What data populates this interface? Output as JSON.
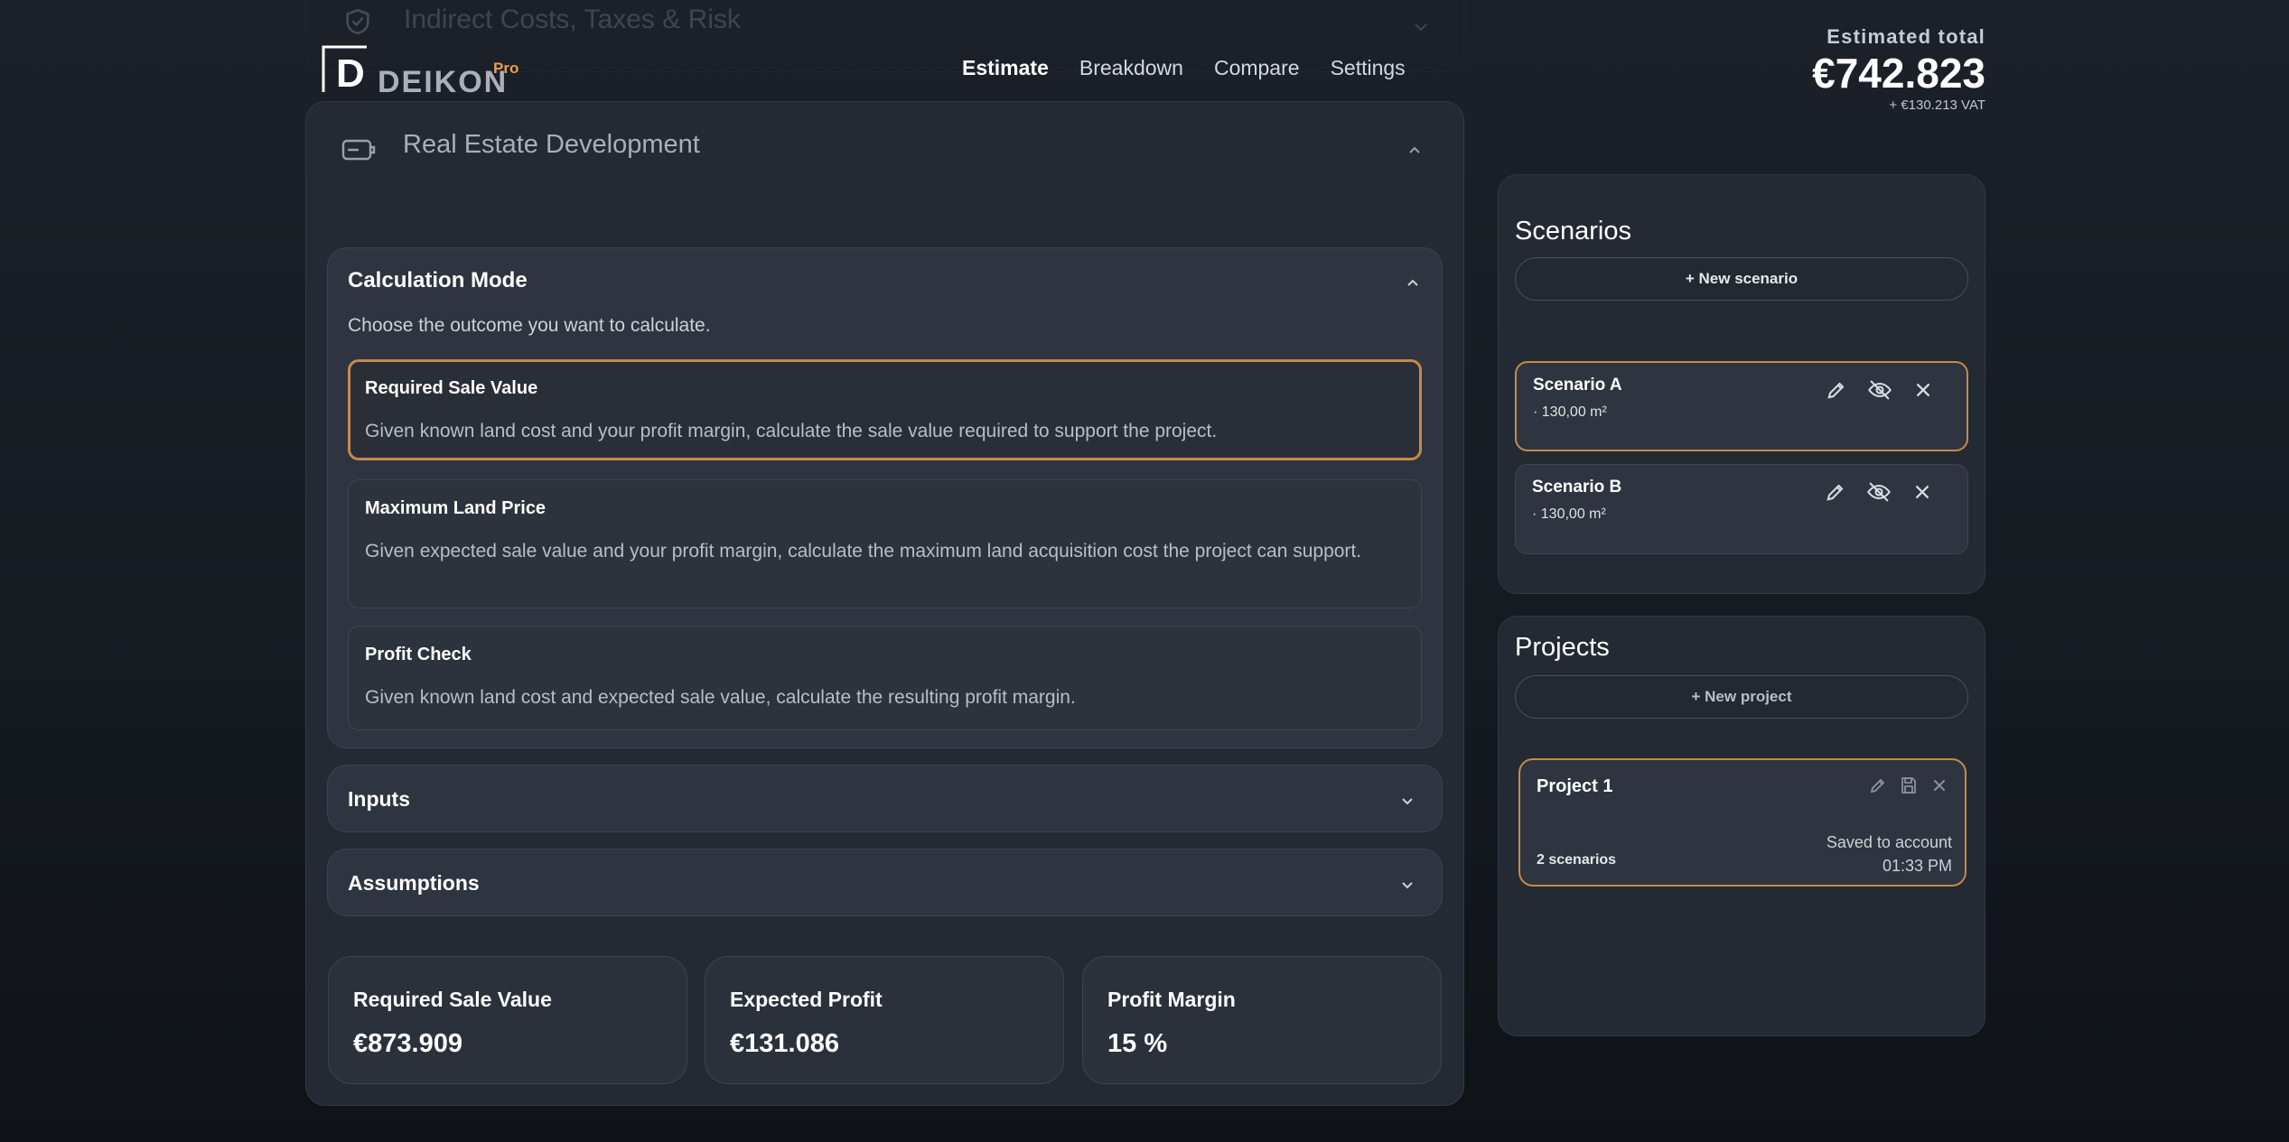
{
  "header": {
    "logo_letter": "D",
    "brand": "DEIKON",
    "badge": "Pro",
    "nav": [
      "Estimate",
      "Breakdown",
      "Compare",
      "Settings"
    ],
    "active_nav": "Estimate",
    "total_label": "Estimated total",
    "total_value": "€742.823",
    "total_vat": "+ €130.213 VAT"
  },
  "ghost_section": {
    "title": "Indirect Costs, Taxes & Risk"
  },
  "section": {
    "title": "Real Estate Development"
  },
  "calc_mode": {
    "title": "Calculation Mode",
    "subtitle": "Choose the outcome you want to calculate.",
    "options": [
      {
        "title": "Required Sale Value",
        "desc": "Given known land cost and your profit margin, calculate the sale value required to support the project.",
        "selected": true
      },
      {
        "title": "Maximum Land Price",
        "desc": "Given expected sale value and your profit margin, calculate the maximum land acquisition cost the project can support.",
        "selected": false
      },
      {
        "title": "Profit Check",
        "desc": "Given known land cost and expected sale value, calculate the resulting profit margin.",
        "selected": false
      }
    ]
  },
  "collapsibles": {
    "inputs": "Inputs",
    "assumptions": "Assumptions"
  },
  "stats": [
    {
      "label": "Required Sale Value",
      "value": "€873.909"
    },
    {
      "label": "Expected Profit",
      "value": "€131.086"
    },
    {
      "label": "Profit Margin",
      "value": "15 %"
    }
  ],
  "scenarios": {
    "title": "Scenarios",
    "new_label": "+ New scenario",
    "items": [
      {
        "name": "Scenario A",
        "area": "· 130,00 m²",
        "selected": true
      },
      {
        "name": "Scenario B",
        "area": "· 130,00 m²",
        "selected": false
      }
    ]
  },
  "projects": {
    "title": "Projects",
    "new_label": "+ New project",
    "items": [
      {
        "name": "Project 1",
        "count": "2 scenarios",
        "status_line1": "Saved to account",
        "status_line2": "01:33 PM"
      }
    ]
  },
  "colors": {
    "accent": "#c48a4c",
    "badge": "#e8a04e",
    "background": "#1a1f26"
  }
}
